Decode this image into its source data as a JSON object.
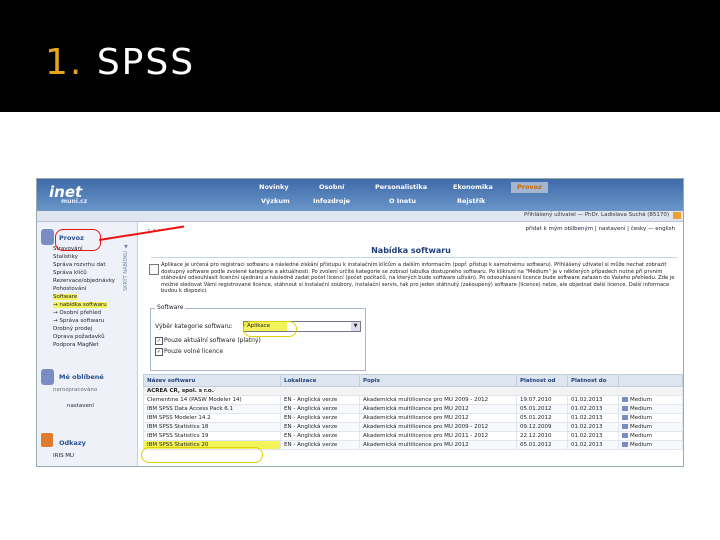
{
  "slide": {
    "number": "1.",
    "title": "SPSS"
  },
  "header": {
    "logo": "inet",
    "logo_sub": "muni.cz",
    "nav_row1": [
      "Novinky",
      "Osobní",
      "Personalistika",
      "Ekonomika",
      "Provoz"
    ],
    "nav_row2": [
      "Výzkum",
      "Infozdroje",
      "O Inetu",
      "Rejstřík"
    ],
    "active_nav": "Provoz",
    "user": "Přihlášený uživatel — PhDr. Ladislava Suchá (85170)",
    "bg_color": "#3e6aa8"
  },
  "sidebar": {
    "vertical_tab": "SKRÝT NABÍDKU ▲",
    "section_title": "Provoz",
    "items": [
      "Stravování",
      "Stalistiky",
      "Správa rozvrhu dat",
      "Správa klíčů",
      "Rezervace/objednávky",
      "Pohostování",
      "Software",
      "→ nabídka softwaru",
      "→ Osobní přehled",
      "→ Správa softwaru",
      "Drobný prodej",
      "Oprava požadavků",
      "Podpora MagNet"
    ],
    "favorites_title": "Mé oblíbené",
    "favorites_sub": "nerozpracováno",
    "favorites_item": "nastavení",
    "links_title": "Odkazy",
    "links_item": "IRIS MU"
  },
  "main": {
    "toplinks": "přidat k mým oblíbeným  |  nastavení  |  česky — english",
    "title": "Nabídka softwaru",
    "info_text": "Aplikace je určená pro registraci softwaru a následné získání přístupu k instalačním klíčům a dalším informacím (popř. přístup k samotnému softwaru). Příhlášený uživatel si může nechat zobrazit dostupný software podle zvolené kategorie a aktuálnosti. Po zvolení určité kategorie se zobrazí tabulka dostupného softwaru. Po kliknutí na \"Médium\" je v některých případech nutné při prvním stáhování odsouhlasit licenční ujednání a následně zadat počet licencí (počet počítačů, na kterých bude software užíván). Po odsouhlasení licence bude software zařazen do Vašeho přehledu. Zde je možné sledovat Vámi registrované licence, stáhnout si instalační soubory, instalační servis, tak pro jeden stáhnutý (zakoupený) software (licence) nelze, ale objednat další licence. Další informace budou k dispozici.",
    "software_legend": "Software",
    "category_label": "Výběr kategorie softwaru:",
    "category_value": "Aplikace",
    "checkbox1": "Pouze aktuální software (platný)",
    "checkbox2": "Pouze volné licence"
  },
  "table": {
    "headers": [
      "Název softwaru",
      "Lokalizace",
      "Popis",
      "Platnost od",
      "Platnost do",
      ""
    ],
    "group": "ACREA CR, spol. s r.o.",
    "rows": [
      [
        "Clementine 14 (PASW Modeler 14)",
        "EN - Anglická verze",
        "Akademická multilicence pro MU 2009 - 2012",
        "19.07.2010",
        "01.02.2013",
        "Medium"
      ],
      [
        "IBM SPSS Data Access Pack 6.1",
        "EN - Anglická verze",
        "Akademická multilicence pro MU 2012",
        "05.01.2012",
        "01.02.2013",
        "Medium"
      ],
      [
        "IBM SPSS Modeler 14.2",
        "EN - Anglická verze",
        "Akademická multilicence pro MU 2012",
        "05.01.2012",
        "01.02.2013",
        "Medium"
      ],
      [
        "IBM SPSS Statistics 18",
        "EN - Anglická verze",
        "Akademická multilicence pro MU 2009 - 2012",
        "09.12.2009",
        "01.02.2013",
        "Medium"
      ],
      [
        "IBM SPSS Statistics 19",
        "EN - Anglická verze",
        "Akademická multilicence pro MU 2011 - 2012",
        "22.12.2010",
        "01.02.2013",
        "Medium"
      ],
      [
        "IBM SPSS Statistics 20",
        "EN - Anglická verze",
        "Akademická multilicence pro MU 2012",
        "05.01.2012",
        "01.02.2013",
        "Medium"
      ]
    ]
  }
}
